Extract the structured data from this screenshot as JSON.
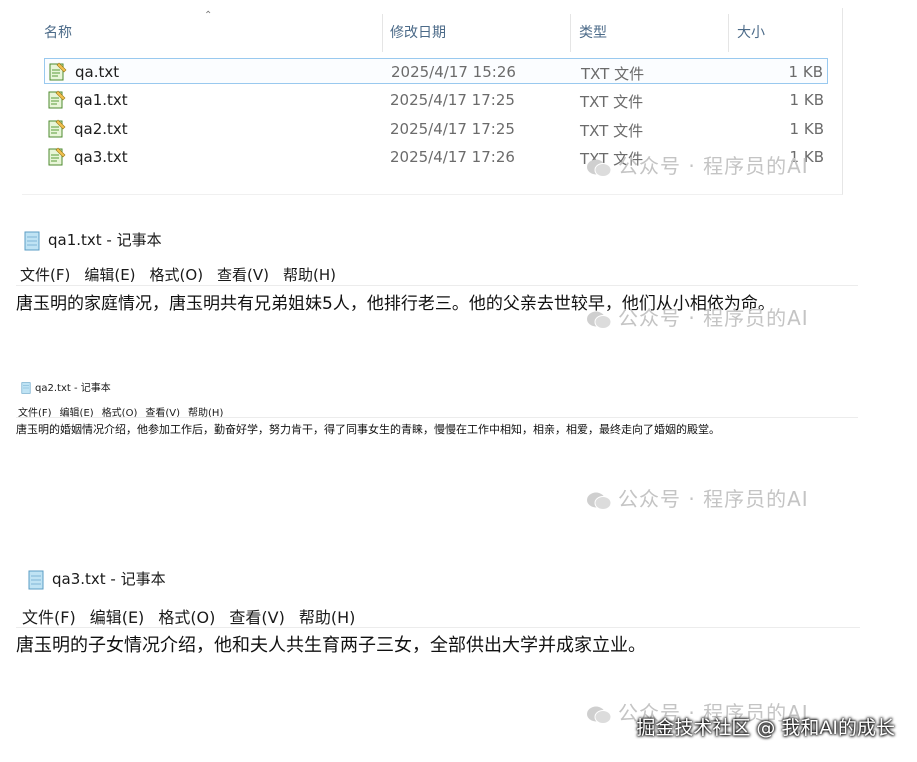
{
  "explorer": {
    "columns": {
      "name": "名称",
      "date": "修改日期",
      "type": "类型",
      "size": "大小"
    },
    "files": [
      {
        "name": "qa.txt",
        "date": "2025/4/17 15:26",
        "type": "TXT 文件",
        "size": "1 KB",
        "selected": true
      },
      {
        "name": "qa1.txt",
        "date": "2025/4/17 17:25",
        "type": "TXT 文件",
        "size": "1 KB"
      },
      {
        "name": "qa2.txt",
        "date": "2025/4/17 17:25",
        "type": "TXT 文件",
        "size": "1 KB"
      },
      {
        "name": "qa3.txt",
        "date": "2025/4/17 17:26",
        "type": "TXT 文件",
        "size": "1 KB"
      }
    ]
  },
  "notepads": [
    {
      "title": "qa1.txt - 记事本",
      "menu": [
        "文件(F)",
        "编辑(E)",
        "格式(O)",
        "查看(V)",
        "帮助(H)"
      ],
      "content": "唐玉明的家庭情况，唐玉明共有兄弟姐妹5人，他排行老三。他的父亲去世较早，他们从小相依为命。"
    },
    {
      "title": "qa2.txt - 记事本",
      "menu": [
        "文件(F)",
        "编辑(E)",
        "格式(O)",
        "查看(V)",
        "帮助(H)"
      ],
      "content": "唐玉明的婚姻情况介绍，他参加工作后，勤奋好学，努力肯干，得了同事女生的青睐，慢慢在工作中相知，相亲，相爱，最终走向了婚姻的殿堂。"
    },
    {
      "title": "qa3.txt - 记事本",
      "menu": [
        "文件(F)",
        "编辑(E)",
        "格式(O)",
        "查看(V)",
        "帮助(H)"
      ],
      "content": "唐玉明的子女情况介绍，他和夫人共生育两子三女，全部供出大学并成家立业。"
    }
  ],
  "watermark": "公众号 · 程序员的AI",
  "footer": "掘金技术社区 @ 我和AI的成长"
}
